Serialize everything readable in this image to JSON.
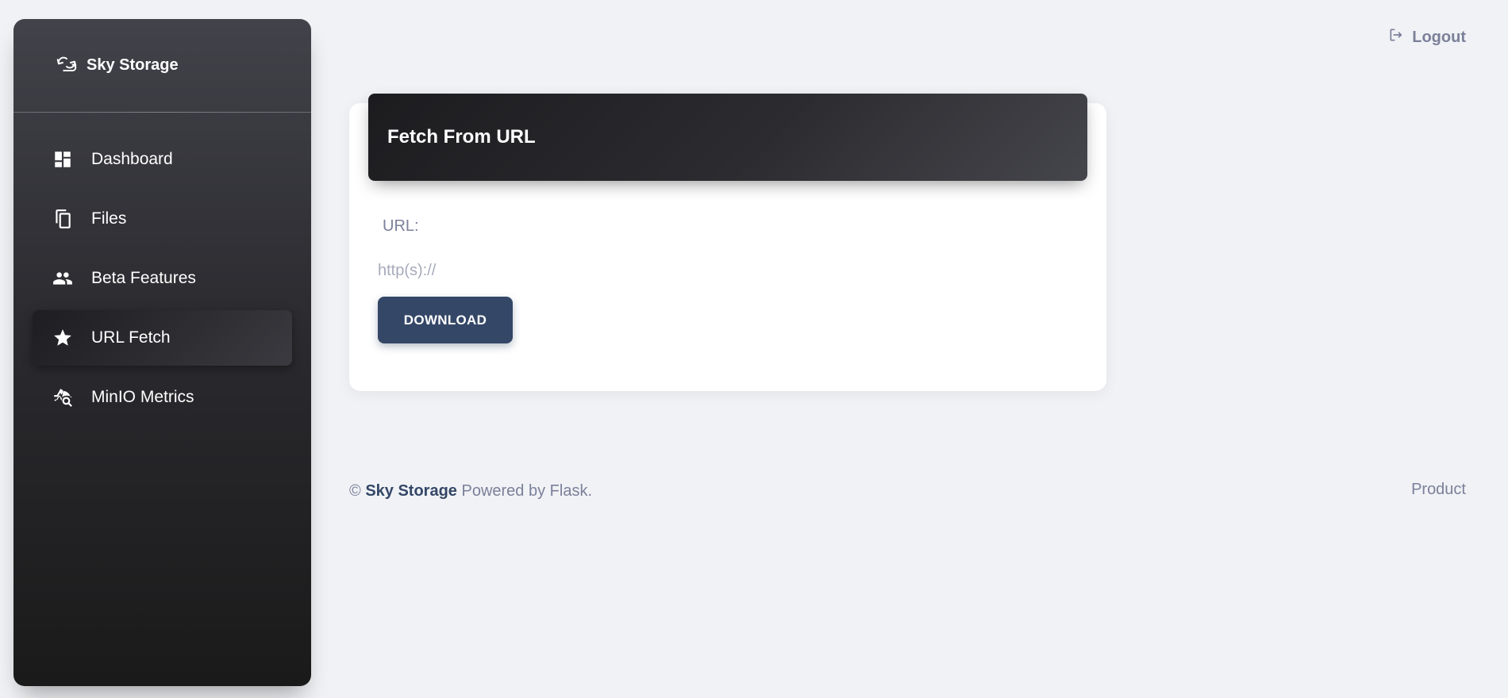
{
  "sidebar": {
    "brand": {
      "title": "Sky Storage",
      "icon": "cloud-sync-icon"
    },
    "items": [
      {
        "label": "Dashboard",
        "icon": "dashboard-icon",
        "active": false
      },
      {
        "label": "Files",
        "icon": "files-icon",
        "active": false
      },
      {
        "label": "Beta Features",
        "icon": "people-icon",
        "active": false
      },
      {
        "label": "URL Fetch",
        "icon": "star-icon",
        "active": true
      },
      {
        "label": "MinIO Metrics",
        "icon": "metrics-icon",
        "active": false
      }
    ]
  },
  "header": {
    "logout_label": "Logout",
    "logout_icon": "logout-icon"
  },
  "card": {
    "title": "Fetch From URL",
    "url_label": "URL:",
    "url_placeholder": "http(s)://",
    "url_value": "",
    "download_label": "DOWNLOAD"
  },
  "footer": {
    "copyright": "©",
    "brand": "Sky Storage",
    "powered": "Powered by Flask.",
    "product_link": "Product"
  },
  "colors": {
    "page_bg": "#f0f2f5",
    "primary": "#344767",
    "muted": "#7b809a",
    "sidebar_dark": "#1a1a1a"
  }
}
